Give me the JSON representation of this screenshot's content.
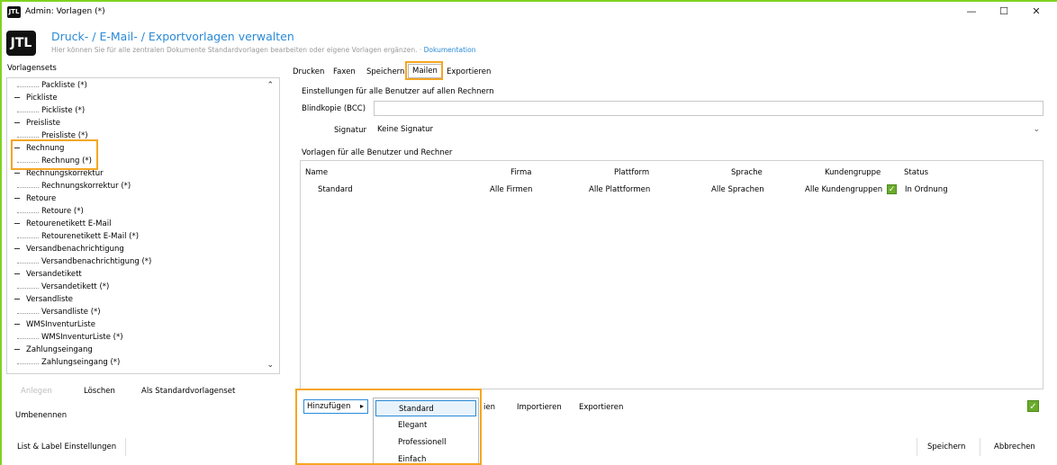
{
  "window": {
    "title": "Admin: Vorlagen (*)",
    "icon_text": "JTL",
    "controls": [
      "—",
      "☐",
      "✕"
    ]
  },
  "header": {
    "logo_text": "JTL",
    "title": "Druck- / E-Mail- / Exportvorlagen verwalten",
    "subtitle": "Hier können Sie für alle zentralen Dokumente Standardvorlagen bearbeiten oder eigene Vorlagen ergänzen.",
    "doc_link": "Dokumentation"
  },
  "sidebar": {
    "label": "Vorlagensets",
    "tree": [
      {
        "label": "Packliste (*)",
        "level": 1
      },
      {
        "label": "Pickliste",
        "level": 0
      },
      {
        "label": "Pickliste (*)",
        "level": 1
      },
      {
        "label": "Preisliste",
        "level": 0
      },
      {
        "label": "Preisliste (*)",
        "level": 1
      },
      {
        "label": "Rechnung",
        "level": 0
      },
      {
        "label": "Rechnung (*)",
        "level": 1
      },
      {
        "label": "Rechnungskorrektur",
        "level": 0
      },
      {
        "label": "Rechnungskorrektur (*)",
        "level": 1
      },
      {
        "label": "Retoure",
        "level": 0
      },
      {
        "label": "Retoure (*)",
        "level": 1
      },
      {
        "label": "Retourenetikett E-Mail",
        "level": 0
      },
      {
        "label": "Retourenetikett E-Mail (*)",
        "level": 1
      },
      {
        "label": "Versandbenachrichtigung",
        "level": 0
      },
      {
        "label": "Versandbenachrichtigung (*)",
        "level": 1
      },
      {
        "label": "Versandetikett",
        "level": 0
      },
      {
        "label": "Versandetikett (*)",
        "level": 1
      },
      {
        "label": "Versandliste",
        "level": 0
      },
      {
        "label": "Versandliste (*)",
        "level": 1
      },
      {
        "label": "WMSInventurListe",
        "level": 0
      },
      {
        "label": "WMSInventurListe (*)",
        "level": 1
      },
      {
        "label": "Zahlungseingang",
        "level": 0
      },
      {
        "label": "Zahlungseingang (*)",
        "level": 1
      }
    ],
    "btn_anlegen": "Anlegen",
    "btn_loeschen": "Löschen",
    "btn_standard": "Als Standardvorlagenset",
    "btn_umbenennen": "Umbenennen",
    "btn_listlabel": "List & Label Einstellungen"
  },
  "tabs": [
    "Drucken",
    "Faxen",
    "Speichern",
    "Mailen",
    "Exportieren"
  ],
  "settings": {
    "section_title": "Einstellungen für alle Benutzer auf allen Rechnern",
    "bcc_label": "Blindkopie (BCC)",
    "bcc_value": "",
    "signature_label": "Signatur",
    "signature_value": "Keine Signatur"
  },
  "templates": {
    "section_title": "Vorlagen für alle Benutzer und Rechner",
    "columns": [
      "Name",
      "Firma",
      "Plattform",
      "Sprache",
      "Kundengruppe",
      "Status"
    ],
    "rows": [
      {
        "name": "Standard",
        "firma": "Alle Firmen",
        "plattform": "Alle Plattformen",
        "sprache": "Alle Sprachen",
        "kundengruppe": "Alle Kundengruppen",
        "status": "In Ordnung"
      }
    ]
  },
  "actions": {
    "add_label": "Hinzufügen",
    "bearbeiten_tail": "ien",
    "importieren": "Importieren",
    "exportieren": "Exportieren"
  },
  "add_menu": {
    "items": [
      "Standard",
      "Elegant",
      "Professionell",
      "Einfach"
    ],
    "selected": "Standard"
  },
  "footer": {
    "save": "Speichern",
    "cancel": "Abbrechen"
  },
  "colors": {
    "accent": "#2a8ad6",
    "highlight": "#f5a623",
    "frame": "#7ed321",
    "ok": "#6aab2c"
  }
}
